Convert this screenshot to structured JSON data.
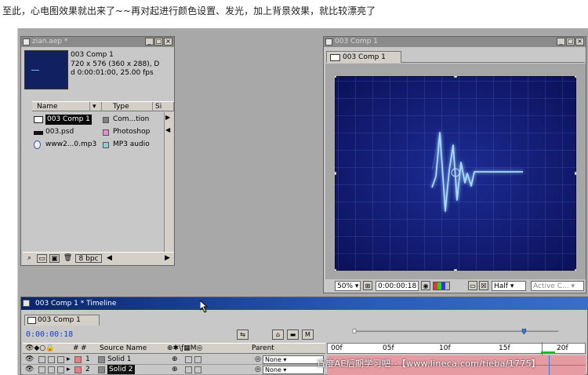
{
  "caption": "至此，心电图效果就出来了~~再对起进行颜色设置、发光，加上背景效果，就比较漂亮了",
  "colors": {
    "desktop": "#a8a8a8",
    "panel": "#c8c8c8",
    "comp_bg": "#101a70",
    "glow": "#9ad8ff",
    "timeline_title": "#0a246a",
    "time_text": "#1a3fc0",
    "layer_bar": "#e69ba3"
  },
  "project": {
    "title": "zian.aep *",
    "comp_name": "003 Comp 1",
    "dimensions": "720 x 576  (360 x 288), D",
    "duration": "d 0:00:01:00, 25.00 fps",
    "columns": {
      "name": "Name",
      "type": "Type",
      "size": "Si"
    },
    "items": [
      {
        "name": "003 Comp 1",
        "type": "Com...tion",
        "swatch": "#808080",
        "icon": "composition-icon"
      },
      {
        "name": "003.psd",
        "type": "Photoshop",
        "swatch": "#e58cd4",
        "icon": "psd-file-icon"
      },
      {
        "name": "www2...0.mp3",
        "type": "MP3 audio",
        "swatch": "#8ed0d4",
        "icon": "audio-file-icon"
      }
    ],
    "bpc": "8 bpc"
  },
  "composition": {
    "title": "003 Comp 1",
    "tab": "003 Comp 1",
    "zoom": "50%",
    "timecode": "0:00:00:18",
    "resolution": "Half",
    "camera": "Active C..."
  },
  "timeline": {
    "title": "003 Comp 1 * Timeline",
    "tab": "003 Comp 1",
    "current_time": "0:00:00:18",
    "columns": {
      "source_name": "Source Name",
      "parent": "Parent"
    },
    "layers": [
      {
        "num": "1",
        "name": "Solid 1",
        "parent": "None"
      },
      {
        "num": "2",
        "name": "Solid 2",
        "parent": "None"
      }
    ],
    "ruler_ticks": [
      "00f",
      "05f",
      "10f",
      "15f",
      "20f"
    ]
  },
  "watermark": "百度AE后期学习吧--【www.lineca.com/tieba/1775】"
}
